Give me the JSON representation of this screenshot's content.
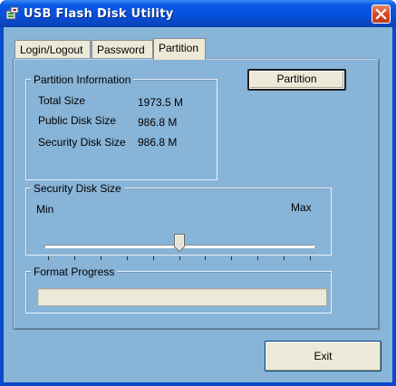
{
  "window": {
    "title": "USB Flash Disk Utility"
  },
  "tabs": [
    {
      "label": "Login/Logout",
      "active": false
    },
    {
      "label": "Password",
      "active": false
    },
    {
      "label": "Partition",
      "active": true
    }
  ],
  "partition_info": {
    "group_label": "Partition Information",
    "rows": [
      {
        "label": "Total Size",
        "value": "1973.5 M"
      },
      {
        "label": "Public Disk Size",
        "value": "986.8 M"
      },
      {
        "label": "Security Disk Size",
        "value": "986.8 M"
      }
    ]
  },
  "partition_button": {
    "label": "Partition"
  },
  "security_slider": {
    "group_label": "Security Disk Size",
    "min_label": "Min",
    "max_label": "Max",
    "tick_count": 11,
    "value_fraction": 0.5
  },
  "format_progress": {
    "group_label": "Format Progress",
    "value_fraction": 0
  },
  "exit_button": {
    "label": "Exit"
  },
  "icons": {
    "app": "usb-disk-icon",
    "close": "close-icon"
  },
  "colors": {
    "titlebar": "#0650dc",
    "client_bg": "#88b4d8",
    "button_face": "#ece9d8",
    "close_button": "#d64a24"
  }
}
